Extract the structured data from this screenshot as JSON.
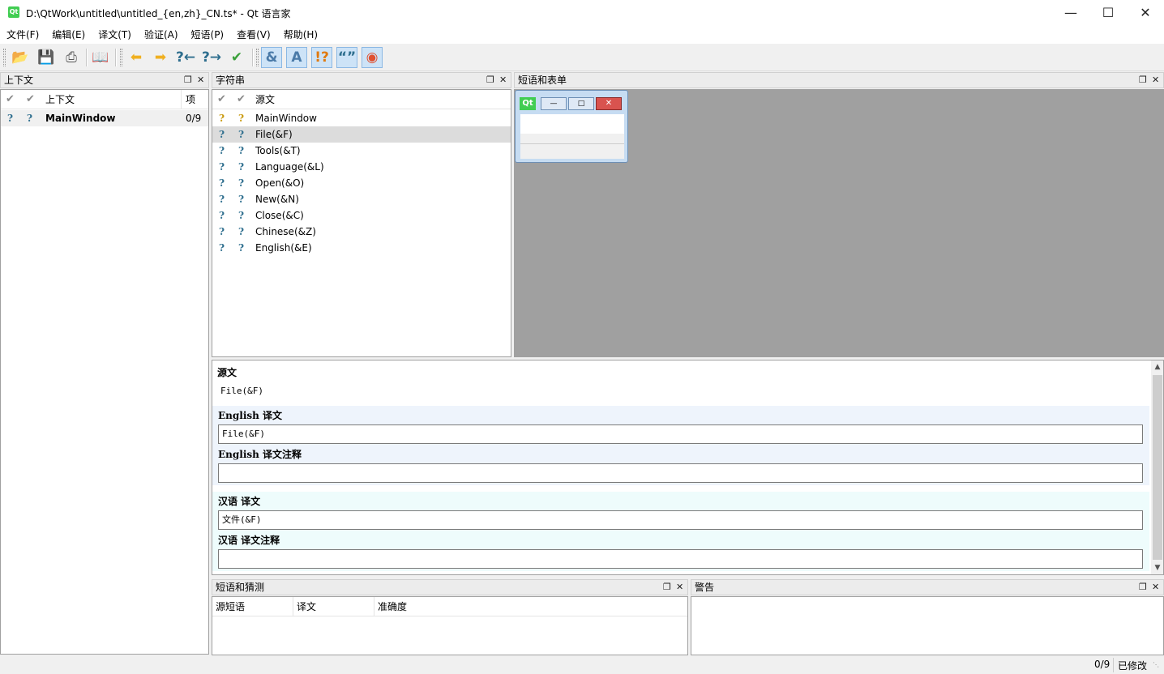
{
  "window": {
    "app_icon_text": "Qt",
    "title": "D:\\QtWork\\untitled\\untitled_{en,zh}_CN.ts* - Qt 语言家",
    "min_icon": "minimize-icon",
    "max_icon": "maximize-icon",
    "close_icon": "close-icon"
  },
  "menu": [
    "文件(F)",
    "编辑(E)",
    "译文(T)",
    "验证(A)",
    "短语(P)",
    "查看(V)",
    "帮助(H)"
  ],
  "toolbar": {
    "icons": [
      "open-folder-icon",
      "save-icon",
      "print-icon",
      "phrasebook-icon",
      "prev-icon",
      "next-icon",
      "prev-unfinished-icon",
      "next-unfinished-icon",
      "done-next-icon",
      "accelerator-validation-icon",
      "surrounding-whitespace-icon",
      "punctuation-validation-icon",
      "phrase-matches-icon",
      "placemarker-validation-icon"
    ]
  },
  "context_panel": {
    "title": "上下文",
    "columns": [
      "上下文",
      "项"
    ],
    "rows": [
      {
        "name": "MainWindow",
        "count": "0/9"
      }
    ]
  },
  "strings_panel": {
    "title": "字符串",
    "column": "源文",
    "rows": [
      "MainWindow",
      "File(&F)",
      "Tools(&T)",
      "Language(&L)",
      "Open(&O)",
      "New(&N)",
      "Close(&C)",
      "Chinese(&Z)",
      "English(&E)"
    ]
  },
  "forms_panel": {
    "title": "短语和表单",
    "preview_window_label": "Qt"
  },
  "editor": {
    "source_label": "源文",
    "source_text": "File(&F)",
    "en_translation_label": "English 译文",
    "en_translation_value": "File(&F)",
    "en_comment_label": "English 译文注释",
    "en_comment_value": "",
    "zh_translation_label": "汉语 译文",
    "zh_translation_value": "文件(&F)",
    "zh_comment_label": "汉语 译文注释",
    "zh_comment_value": ""
  },
  "phrases_panel": {
    "title": "短语和猜测",
    "columns": [
      "源短语",
      "译文",
      "准确度"
    ]
  },
  "warnings_panel": {
    "title": "警告"
  },
  "status": {
    "progress": "0/9",
    "modified": "已修改"
  },
  "colors": {
    "accent": "#cde3f7",
    "selection": "#dcdcdc",
    "preview_bg": "#a0a0a0",
    "band_en": "#eef4fc",
    "band_zh": "#eefcfc"
  }
}
